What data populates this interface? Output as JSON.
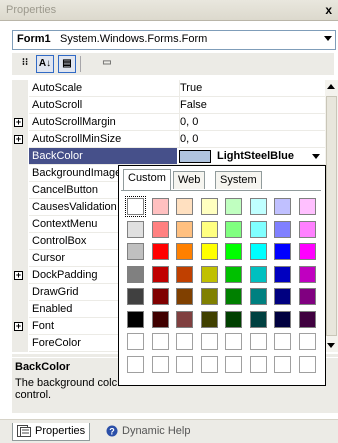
{
  "window": {
    "title": "Properties",
    "close_label": "x"
  },
  "object_selector": {
    "name": "Form1",
    "type": "System.Windows.Forms.Form"
  },
  "toolbar": {
    "buttons": [
      {
        "icon": "categorized-icon",
        "label": "⁝⁝"
      },
      {
        "icon": "alphabetical-icon",
        "label": "A↓"
      },
      {
        "icon": "properties-icon",
        "label": "▤"
      },
      {
        "icon": "events-icon",
        "label": "▭"
      }
    ]
  },
  "properties": [
    {
      "name": "AutoScale",
      "value": "True",
      "expandable": false
    },
    {
      "name": "AutoScroll",
      "value": "False",
      "expandable": false
    },
    {
      "name": "AutoScrollMargin",
      "value": "0, 0",
      "expandable": true
    },
    {
      "name": "AutoScrollMinSize",
      "value": "0, 0",
      "expandable": true
    },
    {
      "name": "BackColor",
      "value": "LightSteelBlue",
      "expandable": false,
      "selected": true,
      "swatch": "#b0c4de"
    },
    {
      "name": "BackgroundImage",
      "value": "",
      "expandable": false
    },
    {
      "name": "CancelButton",
      "value": "",
      "expandable": false
    },
    {
      "name": "CausesValidation",
      "value": "",
      "expandable": false
    },
    {
      "name": "ContextMenu",
      "value": "",
      "expandable": false
    },
    {
      "name": "ControlBox",
      "value": "",
      "expandable": false
    },
    {
      "name": "Cursor",
      "value": "",
      "expandable": false
    },
    {
      "name": "DockPadding",
      "value": "",
      "expandable": true
    },
    {
      "name": "DrawGrid",
      "value": "",
      "expandable": false
    },
    {
      "name": "Enabled",
      "value": "",
      "expandable": false
    },
    {
      "name": "Font",
      "value": "",
      "expandable": true
    },
    {
      "name": "ForeColor",
      "value": "",
      "expandable": false
    }
  ],
  "description": {
    "title": "BackColor",
    "text": "The background colc control."
  },
  "color_picker": {
    "tabs": [
      "Custom",
      "Web",
      "System"
    ],
    "active_tab": "Custom",
    "rows": [
      [
        "#ffffff",
        "#ffc0c0",
        "#ffe0c0",
        "#ffffc0",
        "#c0ffc0",
        "#c0ffff",
        "#c0c0ff",
        "#ffc0ff"
      ],
      [
        "#e0e0e0",
        "#ff8080",
        "#ffc080",
        "#ffff80",
        "#80ff80",
        "#80ffff",
        "#8080ff",
        "#ff80ff"
      ],
      [
        "#c0c0c0",
        "#ff0000",
        "#ff8000",
        "#ffff00",
        "#00ff00",
        "#00ffff",
        "#0000ff",
        "#ff00ff"
      ],
      [
        "#808080",
        "#c00000",
        "#c04000",
        "#c0c000",
        "#00c000",
        "#00c0c0",
        "#0000c0",
        "#c000c0"
      ],
      [
        "#404040",
        "#800000",
        "#804000",
        "#808000",
        "#008000",
        "#008080",
        "#000080",
        "#800080"
      ],
      [
        "#000000",
        "#400000",
        "#804040",
        "#404000",
        "#004000",
        "#004040",
        "#000040",
        "#400040"
      ],
      [
        "",
        "",
        "",
        "",
        "",
        "",
        "",
        ""
      ],
      [
        "",
        "",
        "",
        "",
        "",
        "",
        "",
        ""
      ]
    ]
  },
  "bottom_tabs": [
    {
      "label": "Properties",
      "icon": "properties-page-icon",
      "active": true
    },
    {
      "label": "Dynamic Help",
      "icon": "help-icon",
      "active": false
    }
  ]
}
